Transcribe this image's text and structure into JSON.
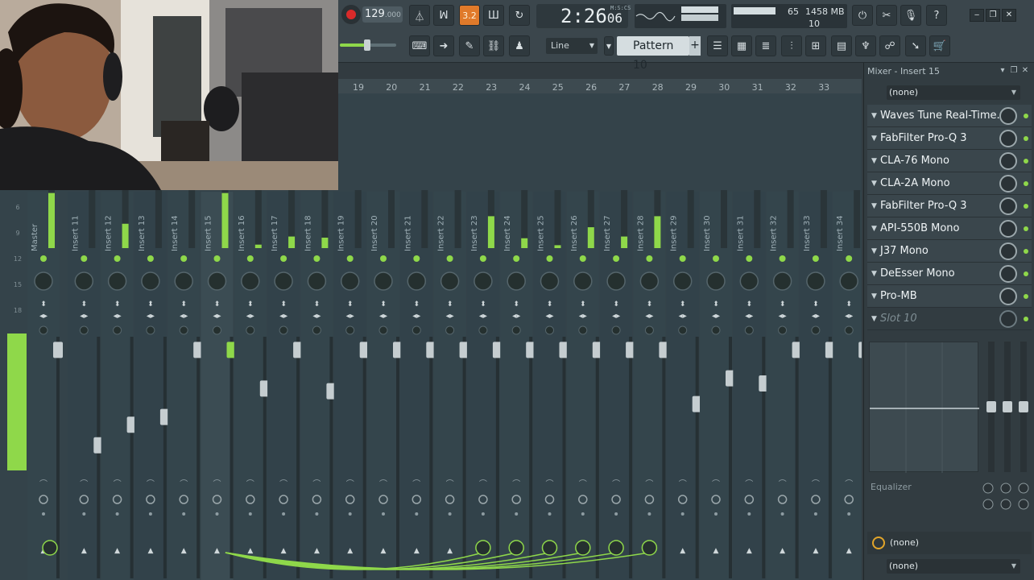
{
  "toolbar": {
    "tempo": "129",
    "tempo_fraction": ".000",
    "song_time": "2:26",
    "song_time_sub": "06",
    "time_format_label": "M:S:CS",
    "pattern_mode_label": "3.2",
    "cpu_value": "65",
    "memory": "1458 MB",
    "polyphony": "10",
    "snap_label": "Line",
    "pattern_label": "Pattern 10",
    "pattern_add": "+",
    "help": "?",
    "tool_icons_row1": [
      "metronome-icon",
      "wait-for-input-icon",
      "countdown-icon",
      "step-edit-icon",
      "loop-record-icon"
    ],
    "tool_icons_row2": [
      "typing-keyboard-icon",
      "step-icon",
      "brush-icon",
      "link-icon",
      "stamp-icon"
    ],
    "window_icons_row2": [
      "playlist-icon",
      "piano-roll-icon",
      "channel-rack-icon",
      "mixer-icon",
      "browser-icon",
      "plugin-picker-icon",
      "touch-keyboard-icon",
      "cloud-icon",
      "shop-icon"
    ],
    "utility_icons": [
      "undo-history-icon",
      "cut-icon",
      "microphone-icon"
    ],
    "window_buttons": [
      "minimize",
      "restore",
      "close"
    ],
    "window_button_glyphs": [
      "‒",
      "❐",
      "✕"
    ]
  },
  "mixer": {
    "track_numbers": [
      "19",
      "20",
      "21",
      "22",
      "23",
      "24",
      "25",
      "26",
      "27",
      "28",
      "29",
      "30",
      "31",
      "32",
      "33"
    ],
    "strip_names": [
      "Master",
      "Insert 11",
      "Insert 12",
      "Insert 13",
      "Insert 14",
      "Insert 15",
      "Insert 16",
      "Insert 17",
      "Insert 18",
      "Insert 19",
      "Insert 20",
      "Insert 21",
      "Insert 22",
      "Insert 23",
      "Insert 24",
      "Insert 25",
      "Insert 26",
      "Insert 27",
      "Insert 28",
      "Insert 29",
      "Insert 30",
      "Insert 31",
      "Insert 32",
      "Insert 33",
      "Insert 34"
    ],
    "db_scale": [
      "6",
      "9",
      "12",
      "15",
      "18"
    ],
    "selected_strip": "Insert 15",
    "fader_levels": [
      0.96,
      0.22,
      0.38,
      0.44,
      0.96,
      0.96,
      0.66,
      0.96,
      0.64,
      0.96,
      0.96,
      0.96,
      0.96,
      0.96,
      0.96,
      0.96,
      0.96,
      0.96,
      0.96,
      0.54,
      0.74,
      0.7,
      0.96,
      0.96,
      0.96
    ],
    "meter_levels": [
      0.95,
      0.0,
      0.42,
      0.0,
      0.0,
      0.95,
      0.06,
      0.2,
      0.18,
      0.0,
      0.0,
      0.0,
      0.0,
      0.55,
      0.17,
      0.05,
      0.36,
      0.2,
      0.55,
      0.0,
      0.0,
      0.0,
      0.0,
      0.0,
      0.0
    ],
    "send_targets": [
      "Insert 23",
      "Insert 24",
      "Insert 25",
      "Insert 26",
      "Insert 27",
      "Insert 28"
    ],
    "colors": {
      "accent_green": "#8fd84a",
      "pan_orange": "#e8a33a",
      "pan_red": "#e0483a",
      "stereo_purple": "#7b5fe0",
      "stereo_cyan": "#6fc6d6"
    }
  },
  "panel": {
    "title": "Mixer - Insert 15",
    "input_select": "(none)",
    "slots": [
      {
        "name": "Waves Tune Real-Time..."
      },
      {
        "name": "FabFilter Pro-Q 3"
      },
      {
        "name": "CLA-76 Mono"
      },
      {
        "name": "CLA-2A Mono"
      },
      {
        "name": "FabFilter Pro-Q 3"
      },
      {
        "name": "API-550B Mono"
      },
      {
        "name": "J37 Mono"
      },
      {
        "name": "DeEsser Mono"
      },
      {
        "name": "Pro-MB"
      },
      {
        "name": "Slot 10"
      }
    ],
    "eq_label": "Equalizer",
    "output_route": "(none)",
    "output_select": "(none)"
  }
}
